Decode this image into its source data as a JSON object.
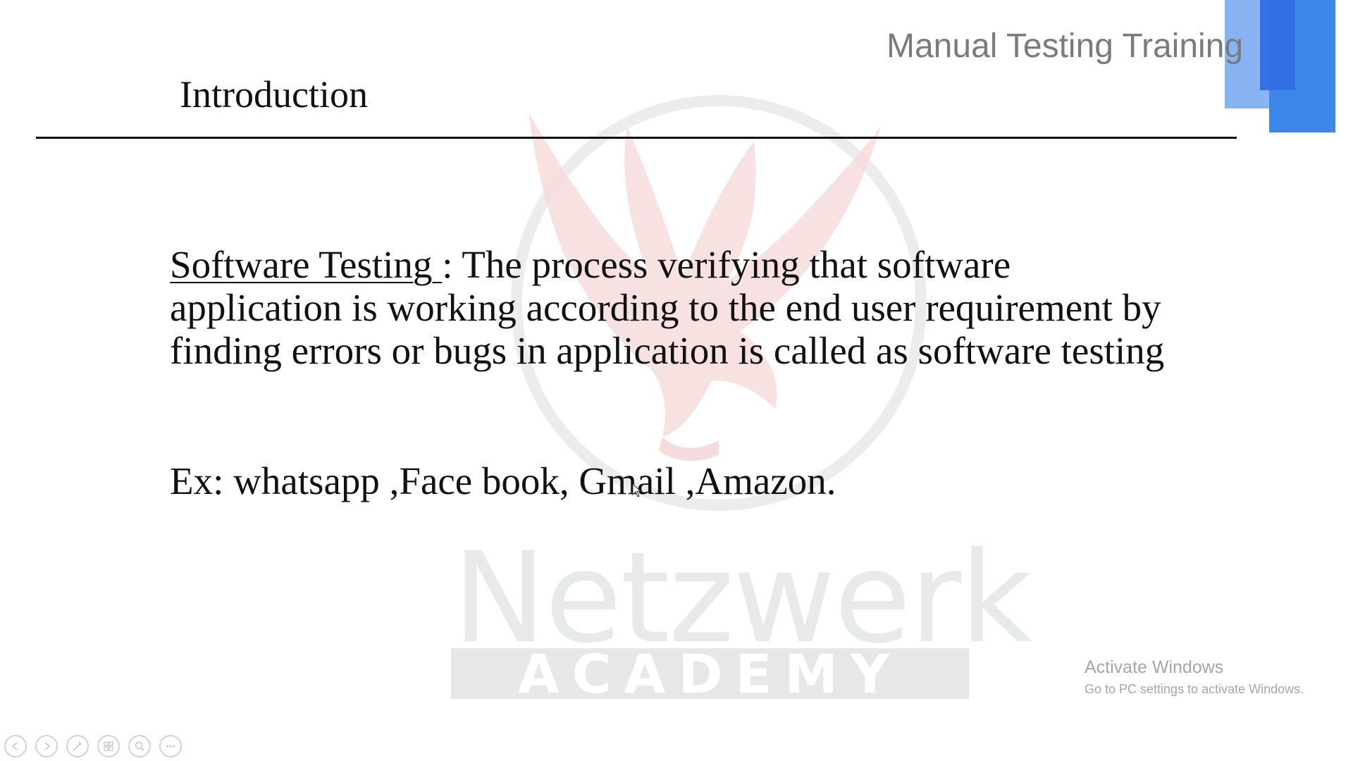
{
  "header": {
    "course_title": "Manual Testing Training",
    "section_title": "Introduction"
  },
  "content": {
    "term": "Software Testing ",
    "definition": ": The process verifying that software application is working according to the end user requirement by finding errors or bugs in application is called as software testing",
    "example": "Ex: whatsapp ,Face book, Gmail ,Amazon."
  },
  "watermark": {
    "logo": "eagle-emblem",
    "wordmark": "Netzwerk",
    "tagline": "ACADEMY"
  },
  "system_notice": {
    "title": "Activate Windows",
    "subtitle": "Go to PC settings to activate Windows."
  },
  "presentation_controls": {
    "icons": [
      "previous-slide-icon",
      "next-slide-icon",
      "pen-icon",
      "slide-grid-icon",
      "zoom-icon",
      "more-options-icon"
    ]
  },
  "colors": {
    "accent_light_blue": "#89b4f3",
    "accent_blue": "#3d86ea",
    "accent_dark_blue": "#2f6fe3",
    "title_gray": "#7b7b7b",
    "watermark_red": "#f6dcdc"
  }
}
